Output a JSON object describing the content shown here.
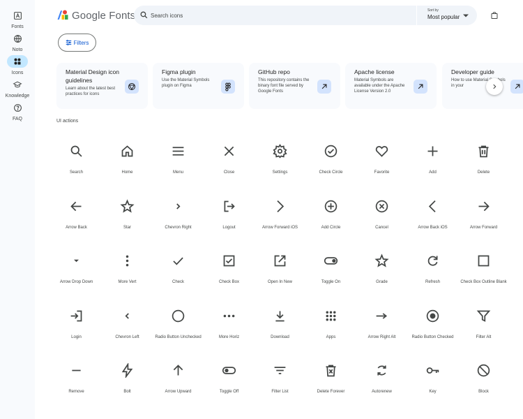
{
  "nav": {
    "items": [
      {
        "label": "Fonts",
        "icon": "fonts-icon"
      },
      {
        "label": "Noto",
        "icon": "globe-icon"
      },
      {
        "label": "Icons",
        "icon": "category-icon",
        "active": true
      },
      {
        "label": "Knowledge",
        "icon": "school-icon"
      },
      {
        "label": "FAQ",
        "icon": "help-icon"
      }
    ]
  },
  "header": {
    "brand": "Google Fonts",
    "search_placeholder": "Search icons",
    "sort_label": "Sort by",
    "sort_value": "Most popular"
  },
  "filters_label": "Filters",
  "cards": [
    {
      "title": "Material Design icon guidelines",
      "desc": "Learn about the latest best practices for icons",
      "icon": "material-logo-icon"
    },
    {
      "title": "Figma plugin",
      "desc": "Use the Material Symbols plugin on Figma",
      "icon": "figma-icon"
    },
    {
      "title": "GitHub repo",
      "desc": "This repository contains the binary font file served by Google Fonts",
      "icon": "arrow-outward-icon"
    },
    {
      "title": "Apache license",
      "desc": "Material Symbols are available under the Apache License Version 2.0",
      "icon": "arrow-outward-icon"
    },
    {
      "title": "Developer guide",
      "desc": "How to use Material Symbols in your",
      "icon": "arrow-outward-icon"
    }
  ],
  "section_title": "UI actions",
  "icons": [
    "Search",
    "Home",
    "Menu",
    "Close",
    "Settings",
    "Check Circle",
    "Favorite",
    "Add",
    "Delete",
    "Arrow Back",
    "Star",
    "Chevron Right",
    "Logout",
    "Arrow Forward iOS",
    "Add Circle",
    "Cancel",
    "Arrow Back iOS",
    "Arrow Forward",
    "Arrow Drop Down",
    "More Vert",
    "Check",
    "Check Box",
    "Open In New",
    "Toggle On",
    "Grade",
    "Refresh",
    "Check Box Outline Blank",
    "Login",
    "Chevron Left",
    "Radio Button Unchecked",
    "More Horiz",
    "Download",
    "Apps",
    "Arrow Right Alt",
    "Radio Button Checked",
    "Filter Alt",
    "Remove",
    "Bolt",
    "Arrow Upward",
    "Toggle Off",
    "Filter List",
    "Delete Forever",
    "Autorenew",
    "Key",
    "Block"
  ],
  "colors": {
    "accent": "#0b57d0",
    "icon": "#444746",
    "active_pill": "#c2e7ff",
    "search_bg": "#f0f4f9",
    "card_bg": "#f8fafd"
  }
}
